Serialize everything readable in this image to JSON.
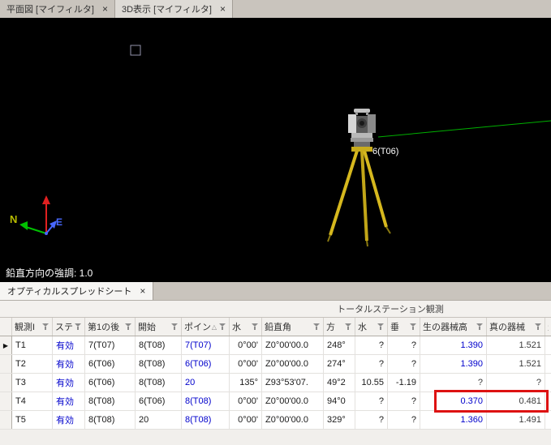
{
  "view_tabs": {
    "tab1": {
      "label": "平面図 [マイフィルタ]",
      "close": "×"
    },
    "tab2": {
      "label": "3D表示 [マイフィルタ]",
      "close": "×"
    }
  },
  "viewport": {
    "station_label": "6(T06)",
    "status_text": "鉛直方向の強調: 1.0",
    "axis_n": "N",
    "axis_e": "E"
  },
  "sheet": {
    "tab": {
      "label": "オプティカルスプレッドシート",
      "close": "×"
    },
    "group_header": "トータルステーション観測",
    "columns": {
      "id": "観測I",
      "status": "ステ",
      "backsight": "第1の後",
      "start": "開始",
      "point": "ポイン",
      "hz": "水",
      "va": "鉛直角",
      "az": "方",
      "hd": "水",
      "vd": "垂",
      "raw_hi": "生の器械高",
      "true_hi": "真の器械",
      "overflow": "生",
      "sort_asc": "△"
    },
    "rows": [
      {
        "marker": "▶",
        "id": "T1",
        "status": "有効",
        "backsight": "7(T07)",
        "start": "8(T08)",
        "point": "7(T07)",
        "hz": "0°00'",
        "va": "Z0°00'00.0",
        "az": "248°",
        "hd": "?",
        "vd": "?",
        "raw_hi": "1.390",
        "true_hi": "1.521"
      },
      {
        "marker": "",
        "id": "T2",
        "status": "有効",
        "backsight": "6(T06)",
        "start": "8(T08)",
        "point": "6(T06)",
        "hz": "0°00'",
        "va": "Z0°00'00.0",
        "az": "274°",
        "hd": "?",
        "vd": "?",
        "raw_hi": "1.390",
        "true_hi": "1.521"
      },
      {
        "marker": "",
        "id": "T3",
        "status": "有効",
        "backsight": "6(T06)",
        "start": "8(T08)",
        "point": "20",
        "hz": "135°",
        "va": "Z93°53'07.",
        "az": "49°2",
        "hd": "10.55",
        "vd": "-1.19",
        "raw_hi": "?",
        "true_hi": "?"
      },
      {
        "marker": "",
        "id": "T4",
        "status": "有効",
        "backsight": "8(T08)",
        "start": "6(T06)",
        "point": "8(T08)",
        "hz": "0°00'",
        "va": "Z0°00'00.0",
        "az": "94°0",
        "hd": "?",
        "vd": "?",
        "raw_hi": "0.370",
        "true_hi": "0.481"
      },
      {
        "marker": "",
        "id": "T5",
        "status": "有効",
        "backsight": "8(T08)",
        "start": "20",
        "point": "8(T08)",
        "hz": "0°00'",
        "va": "Z0°00'00.0",
        "az": "329°",
        "hd": "?",
        "vd": "?",
        "raw_hi": "1.360",
        "true_hi": "1.491"
      }
    ]
  },
  "colors": {
    "highlight_red": "#dd1212",
    "value_blue": "#0000cc",
    "sight_line_green": "#00b000",
    "tripod_yellow": "#d6b81e"
  }
}
